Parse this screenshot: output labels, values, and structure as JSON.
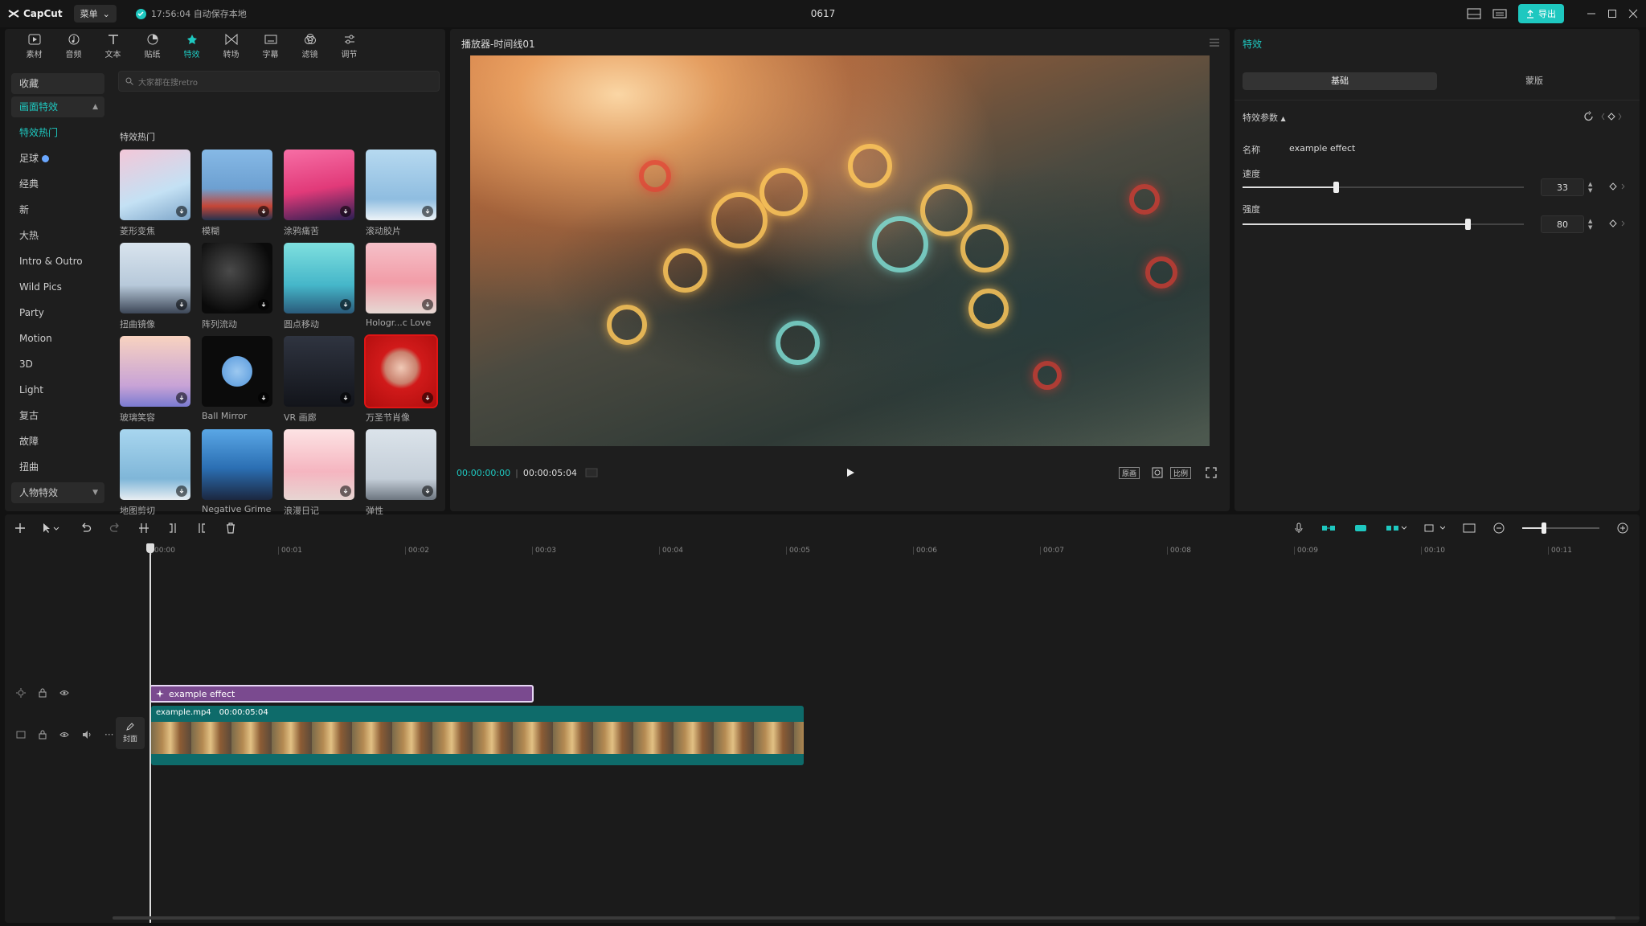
{
  "app": {
    "logo_text": "CapCut",
    "menu_label": "菜单",
    "autosave_text": "17:56:04 自动保存本地",
    "project_title": "0617",
    "export_label": "导出"
  },
  "media_toolbar": [
    {
      "label": "素材",
      "icon": "media-icon"
    },
    {
      "label": "音频",
      "icon": "audio-icon"
    },
    {
      "label": "文本",
      "icon": "text-icon"
    },
    {
      "label": "贴纸",
      "icon": "sticker-icon"
    },
    {
      "label": "特效",
      "icon": "effects-icon",
      "active": true
    },
    {
      "label": "转场",
      "icon": "transition-icon"
    },
    {
      "label": "字幕",
      "icon": "caption-icon"
    },
    {
      "label": "滤镜",
      "icon": "filter-icon"
    },
    {
      "label": "调节",
      "icon": "adjust-icon"
    }
  ],
  "categories": {
    "favorites": "收藏",
    "screen_effects": "画面特效",
    "items": [
      "特效热门",
      "足球",
      "经典",
      "新",
      "大热",
      "Intro & Outro",
      "Wild Pics",
      "Party",
      "Motion",
      "3D",
      "Light",
      "复古",
      "故障",
      "扭曲"
    ],
    "body_effects": "人物特效"
  },
  "search": {
    "placeholder": "大家都在搜retro"
  },
  "effects_section_title": "特效热门",
  "effects": [
    {
      "label": "菱形变焦"
    },
    {
      "label": "模糊"
    },
    {
      "label": "涂鸦痛苦"
    },
    {
      "label": "滚动胶片"
    },
    {
      "label": "扭曲镜像"
    },
    {
      "label": "阵列流动"
    },
    {
      "label": "圆点移动"
    },
    {
      "label": "Hologr...c Love"
    },
    {
      "label": "玻璃笑容"
    },
    {
      "label": "Ball Mirror"
    },
    {
      "label": "VR 画廊"
    },
    {
      "label": "万圣节肖像"
    },
    {
      "label": "地图剪切"
    },
    {
      "label": "Negative Grime"
    },
    {
      "label": "浪漫日记"
    },
    {
      "label": "弹性"
    }
  ],
  "preview": {
    "title": "播放器-时间线01",
    "current_time": "00:00:00:00",
    "duration": "00:00:05:04",
    "btn_original": "原画",
    "btn_ratio": "比例"
  },
  "right_panel": {
    "title": "特效",
    "tab_basic": "基础",
    "tab_mask": "蒙版",
    "section": "特效参数",
    "name_label": "名称",
    "name_value": "example effect",
    "speed_label": "速度",
    "speed_value": "33",
    "speed_fraction": 0.33,
    "intensity_label": "强度",
    "intensity_value": "80",
    "intensity_fraction": 0.8
  },
  "timeline": {
    "ruler": [
      "00:00",
      "00:01",
      "00:02",
      "00:03",
      "00:04",
      "00:05",
      "00:06",
      "00:07",
      "00:08",
      "00:09",
      "00:10",
      "00:11"
    ],
    "effect_clip": "example effect",
    "video_clip_name": "example.mp4",
    "video_clip_duration": "00:00:05:04",
    "cover_label": "封面"
  }
}
